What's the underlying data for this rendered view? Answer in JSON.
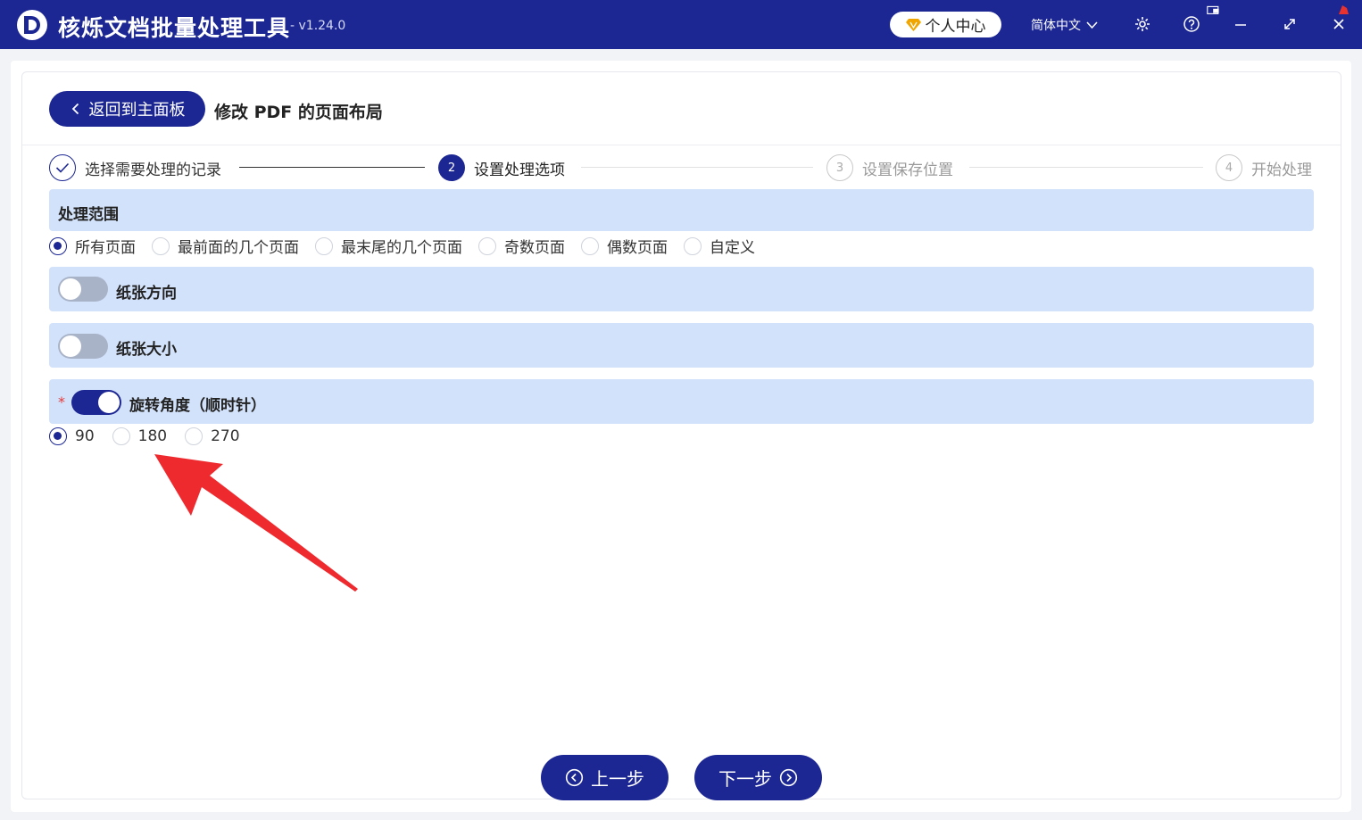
{
  "app": {
    "title": "核烁文档批量处理工具",
    "version": "- v1.24.0",
    "vip_label": "个人中心",
    "language": "简体中文"
  },
  "header": {
    "back_label": "返回到主面板",
    "page_title": "修改 PDF 的页面布局"
  },
  "steps": [
    {
      "number": "",
      "label": "选择需要处理的记录",
      "state": "done"
    },
    {
      "number": "2",
      "label": "设置处理选项",
      "state": "active"
    },
    {
      "number": "3",
      "label": "设置保存位置",
      "state": "todo"
    },
    {
      "number": "4",
      "label": "开始处理",
      "state": "todo"
    }
  ],
  "range": {
    "title": "处理范围",
    "options": [
      "所有页面",
      "最前面的几个页面",
      "最末尾的几个页面",
      "奇数页面",
      "偶数页面",
      "自定义"
    ],
    "selected": "所有页面"
  },
  "orientation": {
    "title": "纸张方向",
    "enabled": false
  },
  "paper_size": {
    "title": "纸张大小",
    "enabled": false
  },
  "rotation": {
    "required_mark": "*",
    "title": "旋转角度（顺时针）",
    "enabled": true,
    "options": [
      "90",
      "180",
      "270"
    ],
    "selected": "90"
  },
  "footer": {
    "prev_label": "上一步",
    "next_label": "下一步"
  },
  "colors": {
    "primary": "#1c2794",
    "section_bg": "#d3e2fb",
    "annotation_arrow": "#ee2a2f"
  }
}
